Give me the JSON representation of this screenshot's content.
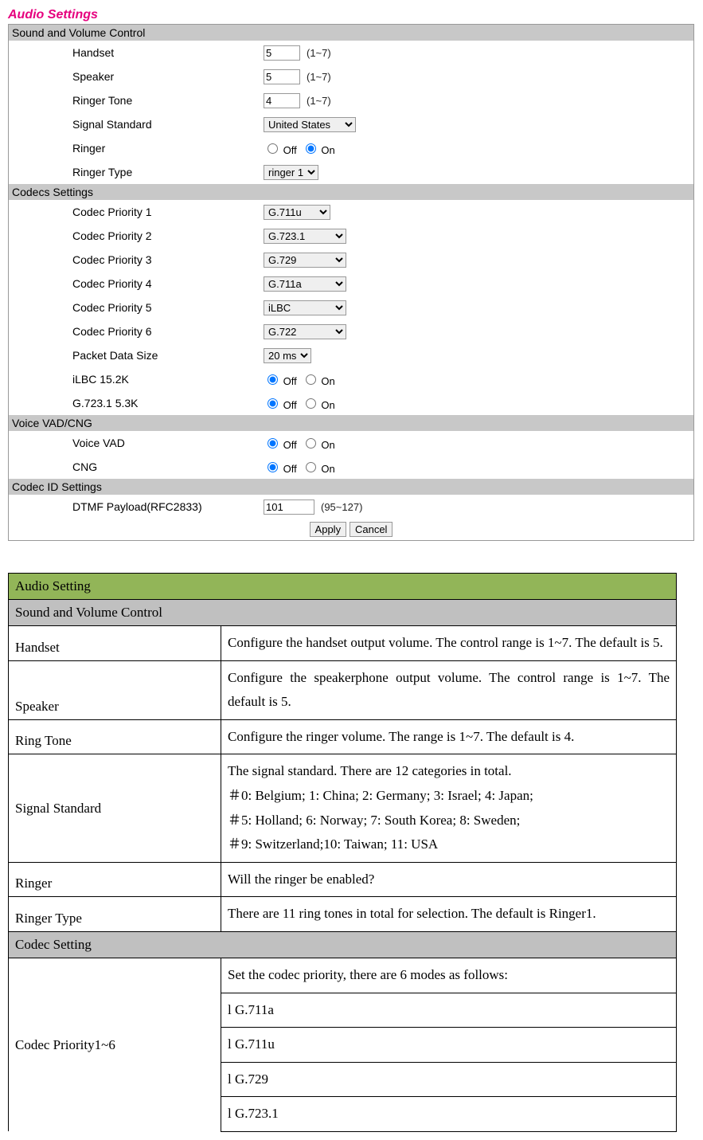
{
  "page_title": "Audio Settings",
  "sections": {
    "sound": {
      "header": "Sound and Volume Control",
      "handset": {
        "label": "Handset",
        "value": "5",
        "hint": "(1~7)"
      },
      "speaker": {
        "label": "Speaker",
        "value": "5",
        "hint": "(1~7)"
      },
      "ringer_tone": {
        "label": "Ringer Tone",
        "value": "4",
        "hint": "(1~7)"
      },
      "signal_standard": {
        "label": "Signal Standard",
        "value": "United States"
      },
      "ringer": {
        "label": "Ringer",
        "off": "Off",
        "on": "On",
        "selected": "on"
      },
      "ringer_type": {
        "label": "Ringer Type",
        "value": "ringer 1"
      }
    },
    "codecs": {
      "header": "Codecs Settings",
      "priority": [
        {
          "label": "Codec Priority 1",
          "value": "G.711u"
        },
        {
          "label": "Codec Priority 2",
          "value": "G.723.1"
        },
        {
          "label": "Codec Priority 3",
          "value": "G.729"
        },
        {
          "label": "Codec Priority 4",
          "value": "G.711a"
        },
        {
          "label": "Codec Priority 5",
          "value": "iLBC"
        },
        {
          "label": "Codec Priority 6",
          "value": "G.722"
        }
      ],
      "packet_size": {
        "label": "Packet Data Size",
        "value": "20 ms"
      },
      "ilbc": {
        "label": "iLBC 15.2K",
        "off": "Off",
        "on": "On",
        "selected": "off"
      },
      "g723": {
        "label": "G.723.1 5.3K",
        "off": "Off",
        "on": "On",
        "selected": "off"
      }
    },
    "vad": {
      "header": "Voice VAD/CNG",
      "voice_vad": {
        "label": "Voice VAD",
        "off": "Off",
        "on": "On",
        "selected": "off"
      },
      "cng": {
        "label": "CNG",
        "off": "Off",
        "on": "On",
        "selected": "off"
      }
    },
    "codec_id": {
      "header": "Codec ID Settings",
      "dtmf": {
        "label": "DTMF Payload(RFC2833)",
        "value": "101",
        "hint": "(95~127)"
      }
    }
  },
  "buttons": {
    "apply": "Apply",
    "cancel": "Cancel"
  },
  "desc": {
    "title": "Audio Setting",
    "sound_header": "Sound and Volume Control",
    "handset": {
      "label": "Handset",
      "text": "Configure the handset output volume. The control range is 1~7. The default is 5."
    },
    "speaker": {
      "label": "Speaker",
      "text": "Configure the speakerphone output volume. The control range is 1~7. The default is 5."
    },
    "ring_tone": {
      "label": "Ring Tone",
      "text": "Configure the ringer volume. The range is 1~7. The default is 4."
    },
    "signal_standard": {
      "label": "Signal Standard",
      "line1": "The signal standard. There are 12 categories in total.",
      "line2": "＃0: Belgium; 1: China; 2: Germany; 3: Israel; 4: Japan;",
      "line3": "＃5: Holland; 6: Norway; 7: South Korea; 8: Sweden;",
      "line4": "＃9: Switzerland;10: Taiwan; 11: USA"
    },
    "ringer": {
      "label": "Ringer",
      "text": "Will the ringer be enabled?"
    },
    "ringer_type": {
      "label": "Ringer Type",
      "text": "There are 11 ring tones in total for selection. The default is Ringer1."
    },
    "codec_header": "Codec Setting",
    "codec_priority": {
      "label": "Codec Priority1~6",
      "line0": "Set the codec priority, there are 6 modes as follows:",
      "line1": "l   G.711a",
      "line2": "l   G.711u",
      "line3": "l   G.729",
      "line4": "l   G.723.1"
    }
  }
}
